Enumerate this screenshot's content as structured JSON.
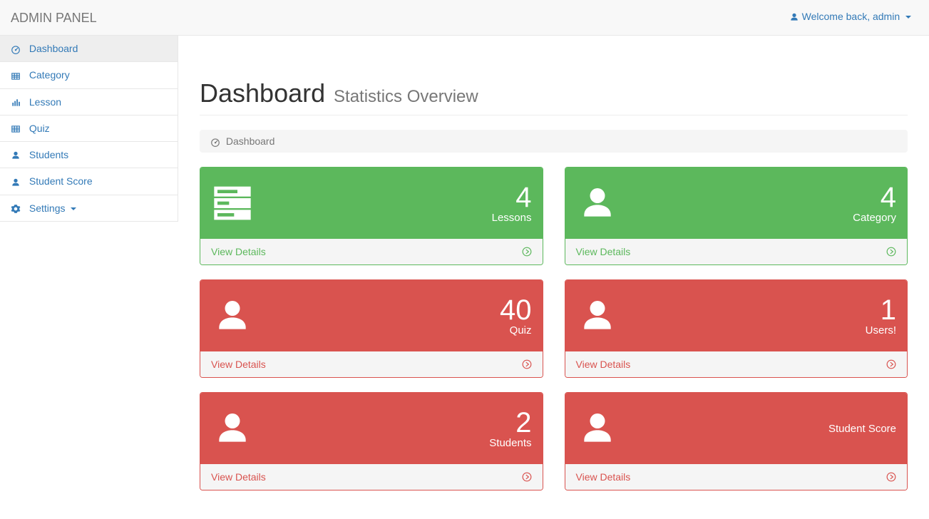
{
  "header": {
    "brand": "ADMIN PANEL",
    "welcome": "Welcome back, admin"
  },
  "sidebar": {
    "items": [
      {
        "label": "Dashboard",
        "icon": "dashboard-icon",
        "active": true
      },
      {
        "label": "Category",
        "icon": "table-icon"
      },
      {
        "label": "Lesson",
        "icon": "bar-chart-icon"
      },
      {
        "label": "Quiz",
        "icon": "table-icon"
      },
      {
        "label": "Students",
        "icon": "user-icon"
      },
      {
        "label": "Student Score",
        "icon": "user-icon"
      },
      {
        "label": "Settings",
        "icon": "gear-icon",
        "caret": true
      }
    ]
  },
  "page": {
    "title": "Dashboard",
    "subtitle": "Statistics Overview",
    "breadcrumb": "Dashboard"
  },
  "cards": [
    {
      "value": "4",
      "label": "Lessons",
      "link": "View Details",
      "color": "green",
      "icon": "tasks-icon"
    },
    {
      "value": "4",
      "label": "Category",
      "link": "View Details",
      "color": "green",
      "icon": "user-icon"
    },
    {
      "value": "40",
      "label": "Quiz",
      "link": "View Details",
      "color": "red",
      "icon": "user-icon"
    },
    {
      "value": "1",
      "label": "Users!",
      "link": "View Details",
      "color": "red",
      "icon": "user-icon"
    },
    {
      "value": "2",
      "label": "Students",
      "link": "View Details",
      "color": "red",
      "icon": "user-icon"
    },
    {
      "value": "",
      "label": "Student Score",
      "link": "View Details",
      "color": "red",
      "icon": "user-icon"
    }
  ],
  "colors": {
    "green": "#5cb85c",
    "red": "#d9534f",
    "link": "#337ab7"
  }
}
